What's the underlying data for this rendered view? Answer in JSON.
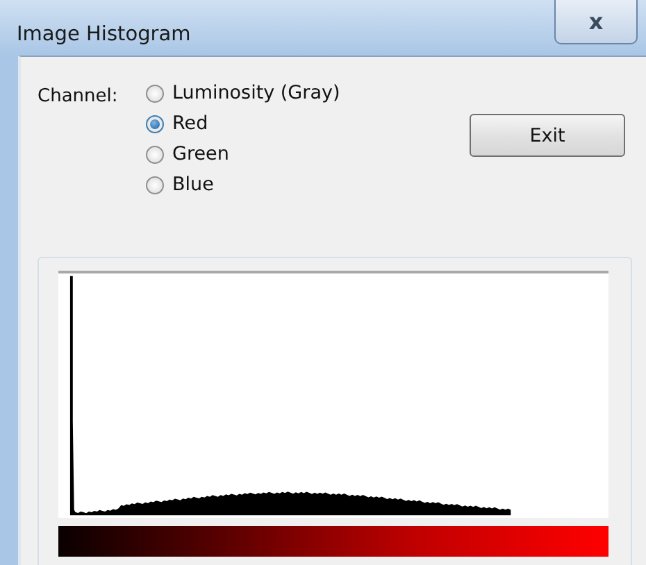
{
  "window": {
    "title": "Image Histogram",
    "close_label": "x"
  },
  "channel": {
    "label": "Channel:",
    "options": [
      {
        "label": "Luminosity (Gray)",
        "selected": false
      },
      {
        "label": "Red",
        "selected": true
      },
      {
        "label": "Green",
        "selected": false
      },
      {
        "label": "Blue",
        "selected": false
      }
    ]
  },
  "buttons": [
    "Exit"
  ]
}
